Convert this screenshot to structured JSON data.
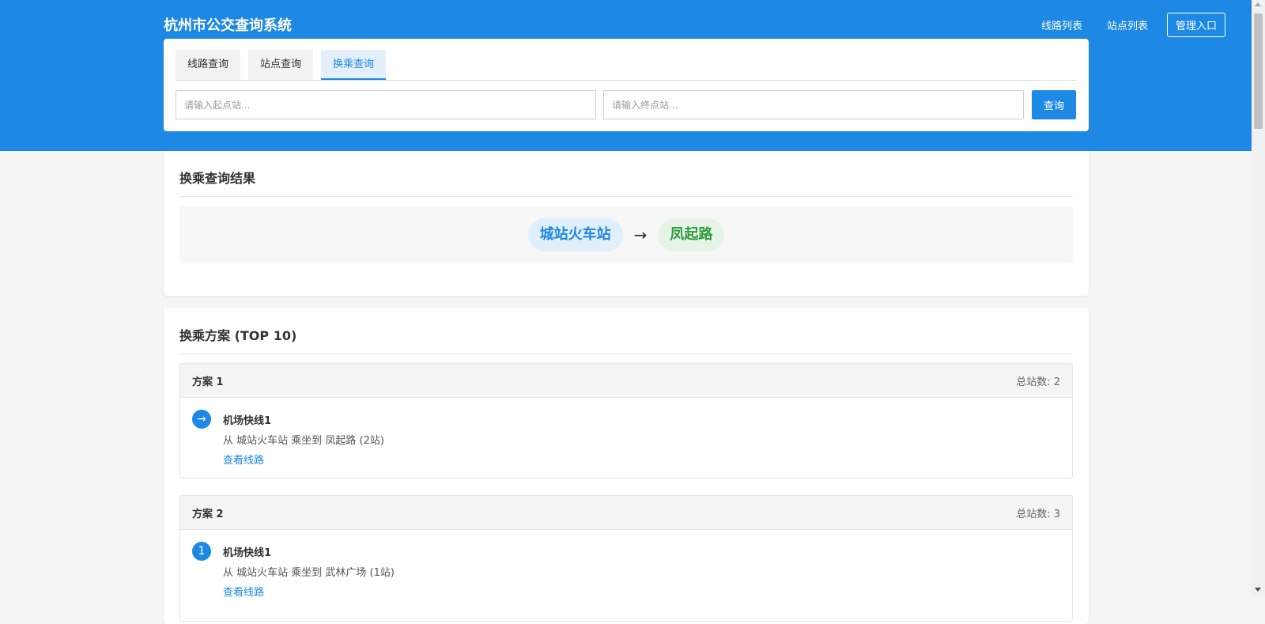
{
  "header": {
    "title": "杭州市公交查询系统",
    "nav": [
      "线路列表",
      "站点列表",
      "管理入口"
    ]
  },
  "search": {
    "tabs": [
      "线路查询",
      "站点查询",
      "换乘查询"
    ],
    "active_tab": "换乘查询",
    "start_placeholder": "请输入起点站...",
    "end_placeholder": "请输入终点站...",
    "start_value": "",
    "end_value": "",
    "button_label": "查询"
  },
  "result": {
    "title": "换乘查询结果",
    "from": "城站火车站",
    "arrow": "→",
    "to": "凤起路"
  },
  "plans": {
    "title": "换乘方案 (TOP 10)",
    "items": [
      {
        "name": "方案 1",
        "total": "总站数: 2",
        "steps": [
          {
            "icon": "→",
            "line": "机场快线1",
            "desc": "从 城站火车站 乘坐到 凤起路 (2站)",
            "link": "查看线路"
          }
        ]
      },
      {
        "name": "方案 2",
        "total": "总站数: 3",
        "steps": [
          {
            "icon": "1",
            "line": "机场快线1",
            "desc": "从 城站火车站 乘坐到 武林广场 (1站)",
            "link": "查看线路"
          }
        ]
      }
    ]
  },
  "colors": {
    "primary": "#1e88e5",
    "from_pill": "#e1effb",
    "to_pill": "#e6f4e8",
    "to_text": "#2e9a3c"
  }
}
